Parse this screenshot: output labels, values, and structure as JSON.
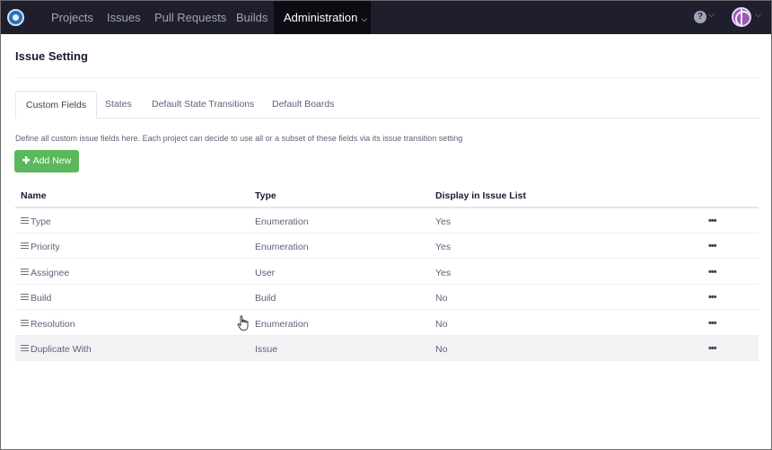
{
  "nav": {
    "items": [
      {
        "label": "Projects"
      },
      {
        "label": "Issues"
      },
      {
        "label": "Pull Requests"
      },
      {
        "label": "Builds"
      },
      {
        "label": "Administration",
        "active": true
      }
    ],
    "help_glyph": "?"
  },
  "page": {
    "title": "Issue Setting",
    "description": "Define all custom issue fields here. Each project can decide to use all or a subset of these fields via its issue transition setting"
  },
  "tabs": [
    {
      "label": "Custom Fields",
      "active": true
    },
    {
      "label": "States"
    },
    {
      "label": "Default State Transitions"
    },
    {
      "label": "Default Boards"
    }
  ],
  "add_button": {
    "label": "Add New"
  },
  "table": {
    "columns": [
      "Name",
      "Type",
      "Display in Issue List"
    ],
    "rows": [
      {
        "name": "Type",
        "type": "Enumeration",
        "display": "Yes"
      },
      {
        "name": "Priority",
        "type": "Enumeration",
        "display": "Yes"
      },
      {
        "name": "Assignee",
        "type": "User",
        "display": "Yes"
      },
      {
        "name": "Build",
        "type": "Build",
        "display": "No"
      },
      {
        "name": "Resolution",
        "type": "Enumeration",
        "display": "No"
      },
      {
        "name": "Duplicate With",
        "type": "Issue",
        "display": "No"
      }
    ],
    "row_menu_glyph": "•••"
  },
  "colors": {
    "navbar": "#1e1e2d",
    "nav_active": "#0c0c14",
    "add_button": "#5cb85c"
  },
  "icons": [
    "app-logo-icon",
    "help-icon",
    "chevron-down-icon",
    "avatar",
    "plus-icon",
    "drag-handle-icon",
    "more-options-icon",
    "hand-cursor-icon"
  ]
}
